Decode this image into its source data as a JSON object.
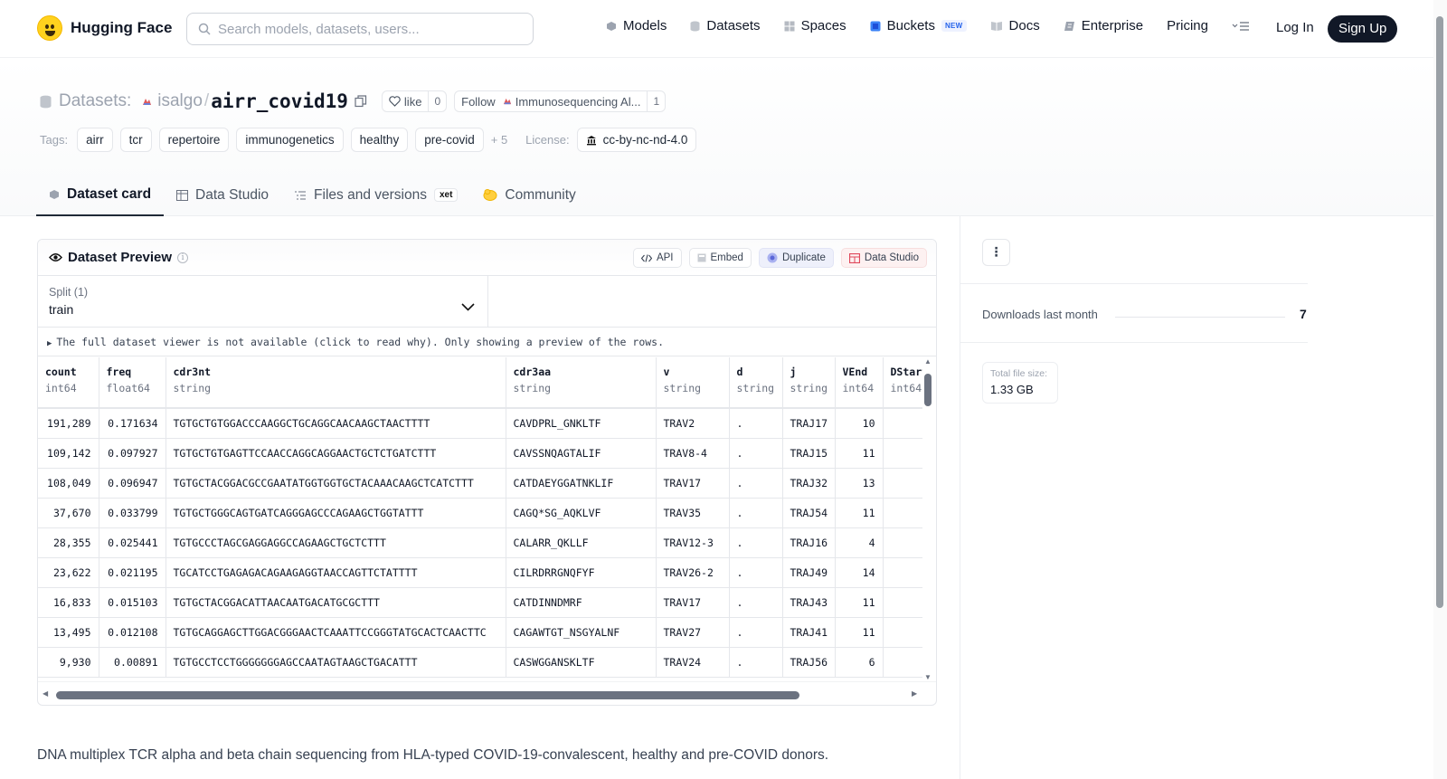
{
  "header": {
    "brand": "Hugging Face",
    "search_placeholder": "Search models, datasets, users...",
    "nav": [
      {
        "label": "Models",
        "icon": "models-icon",
        "color": "#6b7280"
      },
      {
        "label": "Datasets",
        "icon": "datasets-icon",
        "color": "#9ca3af"
      },
      {
        "label": "Spaces",
        "icon": "spaces-icon",
        "color": "#9ca3af"
      },
      {
        "label": "Buckets",
        "icon": "buckets-icon",
        "color": "#2563eb",
        "badge": "NEW"
      },
      {
        "label": "Docs",
        "icon": "docs-icon",
        "color": "#9ca3af"
      },
      {
        "label": "Enterprise",
        "icon": "enterprise-icon",
        "color": "#6b7280"
      },
      {
        "label": "Pricing"
      }
    ],
    "login": "Log In",
    "signup": "Sign Up"
  },
  "repo": {
    "type_label": "Datasets:",
    "owner": "isalgo",
    "separator": "/",
    "name": "airr_covid19",
    "like_label": "like",
    "like_count": "0",
    "follow_label": "Follow",
    "follow_org": "Immunosequencing Al...",
    "follow_count": "1",
    "tags_label": "Tags:",
    "tags": [
      "airr",
      "tcr",
      "repertoire",
      "immunogenetics",
      "healthy",
      "pre-covid"
    ],
    "more_tags": "+ 5",
    "license_label": "License:",
    "license": "cc-by-nc-nd-4.0"
  },
  "tabs": [
    {
      "label": "Dataset card",
      "icon": "dataset-card-icon",
      "active": true
    },
    {
      "label": "Data Studio",
      "icon": "data-studio-icon"
    },
    {
      "label": "Files and versions",
      "icon": "files-icon",
      "badge": "xet"
    },
    {
      "label": "Community",
      "icon": "community-icon"
    }
  ],
  "preview": {
    "title": "Dataset Preview",
    "buttons": {
      "api": "API",
      "embed": "Embed",
      "duplicate": "Duplicate",
      "data_studio": "Data Studio"
    },
    "split_label": "Split (1)",
    "split_value": "train",
    "notice": "The full dataset viewer is not available (click to read why). Only showing a preview of the rows.",
    "columns": [
      {
        "name": "count",
        "type": "int64"
      },
      {
        "name": "freq",
        "type": "float64"
      },
      {
        "name": "cdr3nt",
        "type": "string"
      },
      {
        "name": "cdr3aa",
        "type": "string"
      },
      {
        "name": "v",
        "type": "string"
      },
      {
        "name": "d",
        "type": "string"
      },
      {
        "name": "j",
        "type": "string"
      },
      {
        "name": "VEnd",
        "type": "int64"
      },
      {
        "name": "DStart",
        "type": "int64"
      }
    ],
    "rows": [
      [
        "191,289",
        "0.171634",
        "TGTGCTGTGGACCCAAGGCTGCAGGCAACAAGCTAACTTTT",
        "CAVDPRL_GNKLTF",
        "TRAV2",
        ".",
        "TRAJ17",
        "10",
        ""
      ],
      [
        "109,142",
        "0.097927",
        "TGTGCTGTGAGTTCCAACCAGGCAGGAACTGCTCTGATCTTT",
        "CAVSSNQAGTALIF",
        "TRAV8-4",
        ".",
        "TRAJ15",
        "11",
        ""
      ],
      [
        "108,049",
        "0.096947",
        "TGTGCTACGGACGCCGAATATGGTGGTGCTACAAACAAGCTCATCTTT",
        "CATDAEYGGATNKLIF",
        "TRAV17",
        ".",
        "TRAJ32",
        "13",
        ""
      ],
      [
        "37,670",
        "0.033799",
        "TGTGCTGGGCAGTGATCAGGGAGCCCAGAAGCTGGTATTT",
        "CAGQ*SG_AQKLVF",
        "TRAV35",
        ".",
        "TRAJ54",
        "11",
        ""
      ],
      [
        "28,355",
        "0.025441",
        "TGTGCCCTAGCGAGGAGGCCAGAAGCTGCTCTTT",
        "CALARR_QKLLF",
        "TRAV12-3",
        ".",
        "TRAJ16",
        "4",
        ""
      ],
      [
        "23,622",
        "0.021195",
        "TGCATCCTGAGAGACAGAAGAGGTAACCAGTTCTATTTT",
        "CILRDRRGNQFYF",
        "TRAV26-2",
        ".",
        "TRAJ49",
        "14",
        ""
      ],
      [
        "16,833",
        "0.015103",
        "TGTGCTACGGACATTAACAATGACATGCGCTTT",
        "CATDINNDMRF",
        "TRAV17",
        ".",
        "TRAJ43",
        "11",
        ""
      ],
      [
        "13,495",
        "0.012108",
        "TGTGCAGGAGCTTGGACGGGAACTCAAATTCCGGGTATGCACTCAACTTC",
        "CAGAWTGT_NSGYALNF",
        "TRAV27",
        ".",
        "TRAJ41",
        "11",
        ""
      ],
      [
        "9,930",
        "0.00891",
        "TGTGCCTCCTGGGGGGGAGCCAATAGTAAGCTGACATTT",
        "CASWGGANSKLTF",
        "TRAV24",
        ".",
        "TRAJ56",
        "6",
        ""
      ]
    ],
    "description": "DNA multiplex TCR alpha and beta chain sequencing from HLA-typed COVID-19-convalescent, healthy and pre-COVID donors."
  },
  "sidebar": {
    "downloads_label": "Downloads last month",
    "downloads_value": "7",
    "file_size_label": "Total file size:",
    "file_size_value": "1.33 GB"
  }
}
